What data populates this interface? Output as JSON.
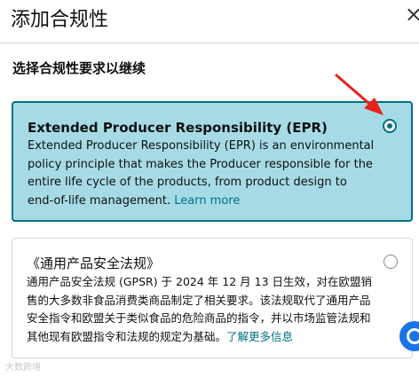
{
  "dialog": {
    "title": "添加合规性",
    "close_icon": "close-icon",
    "subtitle": "选择合规性要求以继续"
  },
  "options": [
    {
      "title": "Extended Producer Responsibility (EPR)",
      "description": "Extended Producer Responsibility (EPR) is an environmental policy principle that makes the Producer responsible for the entire life cycle of the products, from product design to end-of-life management.",
      "link": "Learn more",
      "selected": true
    },
    {
      "title": "《通用产品安全法规》",
      "description": "通用产品安全法规 (GPSR) 于 2024 年 12 月 13 日生效，对在欧盟销售的大多数非食品消费类商品制定了相关要求。该法规取代了通用产品安全指令和欧盟关于类似食品的危险商品的指令，并以市场监管法规和其他现有欧盟指令和法规的规定为基础。",
      "link": "了解更多信息",
      "selected": false
    }
  ],
  "colors": {
    "selected_bg": "#a6dbe6",
    "accent": "#007185",
    "arrow": "#e8221b"
  },
  "watermark": "大数跨境"
}
